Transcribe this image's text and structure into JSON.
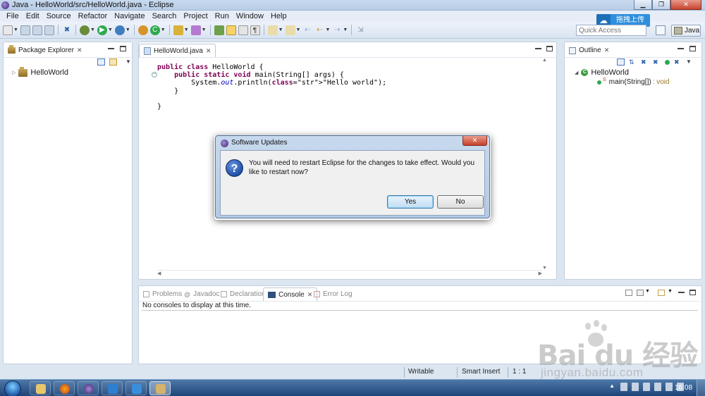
{
  "window": {
    "title": "Java - HelloWorld/src/HelloWorld.java - Eclipse",
    "min_icon": "minimize-icon",
    "max_icon": "maximize-icon",
    "close_glyph": "✕"
  },
  "menubar": {
    "items": [
      "File",
      "Edit",
      "Source",
      "Refactor",
      "Navigate",
      "Search",
      "Project",
      "Run",
      "Window",
      "Help"
    ]
  },
  "toolbar": {
    "quick_access_placeholder": "Quick Access",
    "perspective_label": "Java",
    "upload_badge": "拖拽上传"
  },
  "package_explorer": {
    "tab_label": "Package Explorer",
    "tree": [
      {
        "label": "HelloWorld",
        "icon": "java-project-icon"
      }
    ]
  },
  "editor": {
    "tab_label": "HelloWorld.java",
    "code_lines": [
      "public class HelloWorld {",
      "    public static void main(String[] args) {",
      "        System.out.println(\"Hello world\");",
      "    }",
      "",
      "}"
    ]
  },
  "outline": {
    "tab_label": "Outline",
    "class_name": "HelloWorld",
    "method_name": "main(String[])",
    "method_return": ": void",
    "method_modifier": "S"
  },
  "console": {
    "tabs": [
      {
        "label": "Problems",
        "active": false
      },
      {
        "label": "Javadoc",
        "active": false
      },
      {
        "label": "Declaration",
        "active": false
      },
      {
        "label": "Console",
        "active": true
      },
      {
        "label": "Error Log",
        "active": false
      }
    ],
    "message": "No consoles to display at this time."
  },
  "statusbar": {
    "writable": "Writable",
    "insert_mode": "Smart Insert",
    "position": "1 : 1"
  },
  "dialog": {
    "title": "Software Updates",
    "message": "You will need to restart Eclipse for the changes to take effect. Would you like to restart now?",
    "yes_label": "Yes",
    "no_label": "No",
    "close_glyph": "✕",
    "icon": "question-icon"
  },
  "taskbar": {
    "clock": "16:08",
    "apps": [
      "file-explorer-icon",
      "firefox-icon",
      "eclipse-icon",
      "security-icon",
      "upload-tool-icon",
      "java-app-icon"
    ]
  },
  "watermark": {
    "logo_text": "Bai du 经验",
    "url": "jingyan.baidu.com"
  },
  "colors": {
    "keyword": "#7f0055",
    "string": "#2a00ff",
    "field": "#0000c0",
    "taskbar": "#1f4578"
  }
}
